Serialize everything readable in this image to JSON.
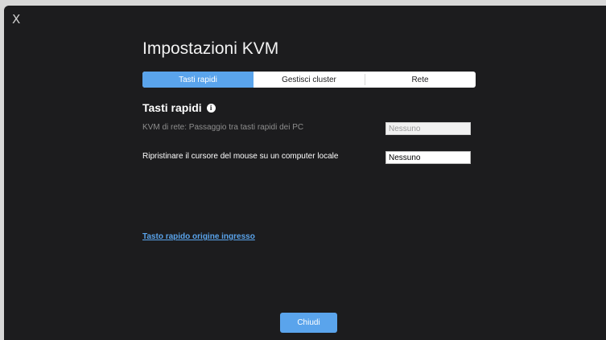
{
  "window": {
    "close_glyph": "X"
  },
  "header": {
    "title": "Impostazioni KVM"
  },
  "tabs": [
    {
      "label": "Tasti rapidi",
      "active": true
    },
    {
      "label": "Gestisci cluster",
      "active": false
    },
    {
      "label": "Rete",
      "active": false
    }
  ],
  "section": {
    "title": "Tasti rapidi",
    "info_icon": "info-icon"
  },
  "rows": [
    {
      "label": "KVM di rete: Passaggio tra tasti rapidi dei PC",
      "value": "Nessuno",
      "enabled": false
    },
    {
      "label": "Ripristinare il cursore del mouse su un computer locale",
      "value": "Nessuno",
      "enabled": true
    }
  ],
  "link": {
    "label": "Tasto rapido origine ingresso"
  },
  "footer": {
    "close_label": "Chiudi"
  },
  "colors": {
    "accent": "#5aa4ec",
    "background": "#1c1c1e"
  }
}
